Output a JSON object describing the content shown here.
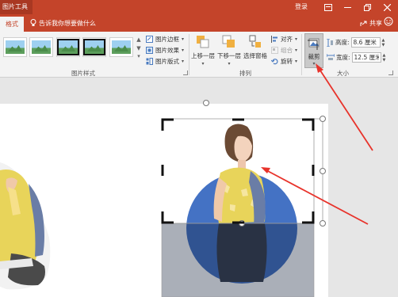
{
  "titlebar": {
    "context_tab": "图片工具",
    "login": "登录"
  },
  "tabs": {
    "active": "格式",
    "tell_me": "告诉我你想要做什么",
    "share": "共享"
  },
  "ribbon": {
    "picture_styles": {
      "label": "图片样式",
      "border": "图片边框",
      "effects": "图片效果",
      "layout": "图片版式"
    },
    "arrange": {
      "label": "排列",
      "bring_forward": "上移一层",
      "send_backward": "下移一层",
      "selection_pane": "选择窗格",
      "align": "对齐",
      "group": "组合",
      "rotate": "旋转"
    },
    "size": {
      "label": "大小",
      "crop": "裁剪",
      "height_label": "高度:",
      "height_value": "8.6 厘米",
      "width_label": "宽度:",
      "width_value": "12.5 厘米"
    }
  },
  "colors": {
    "accent": "#c4442a",
    "circle": "#4472c4",
    "annotation": "#e8332b"
  },
  "icons": [
    "warning-icon",
    "restore-icon",
    "minimize-icon",
    "close-icon",
    "lightbulb-icon",
    "share-icon",
    "smiley-icon",
    "crop-icon",
    "height-icon",
    "width-icon"
  ]
}
